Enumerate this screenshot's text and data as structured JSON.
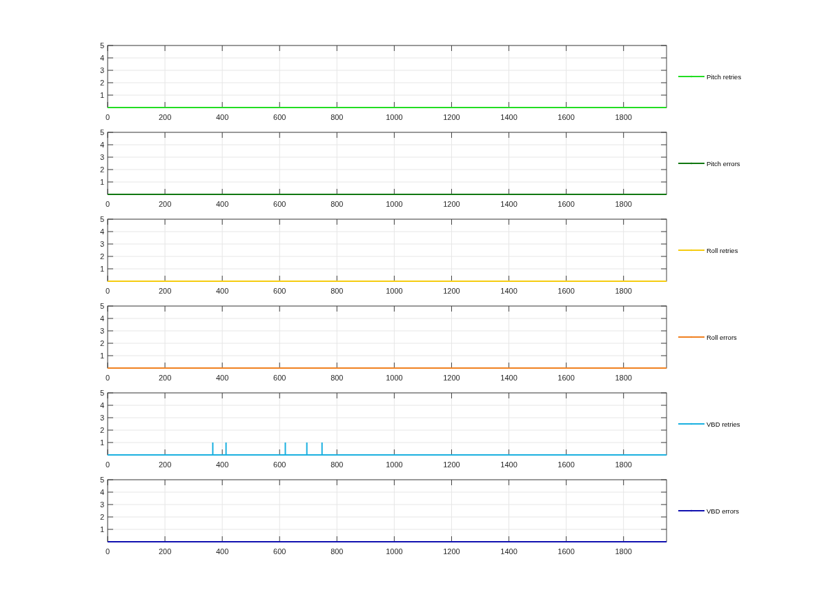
{
  "figure": {
    "subplots": [
      {
        "chart_data": {
          "type": "line",
          "xlim": [
            0,
            1950
          ],
          "ylim": [
            0,
            5
          ],
          "xticks": [
            0,
            200,
            400,
            600,
            800,
            1000,
            1200,
            1400,
            1600,
            1800
          ],
          "yticks": [
            1,
            2,
            3,
            4,
            5
          ],
          "x": [
            0,
            1950
          ],
          "grid": true,
          "series": [
            {
              "name": "Pitch retries",
              "color": "#22dd22",
              "values": [
                0,
                0
              ]
            }
          ]
        }
      },
      {
        "chart_data": {
          "type": "line",
          "xlim": [
            0,
            1950
          ],
          "ylim": [
            0,
            5
          ],
          "xticks": [
            0,
            200,
            400,
            600,
            800,
            1000,
            1200,
            1400,
            1600,
            1800
          ],
          "yticks": [
            1,
            2,
            3,
            4,
            5
          ],
          "x": [
            0,
            1950
          ],
          "grid": true,
          "series": [
            {
              "name": "Pitch errors",
              "color": "#117711",
              "values": [
                0,
                0
              ]
            }
          ]
        }
      },
      {
        "chart_data": {
          "type": "line",
          "xlim": [
            0,
            1950
          ],
          "ylim": [
            0,
            5
          ],
          "xticks": [
            0,
            200,
            400,
            600,
            800,
            1000,
            1200,
            1400,
            1600,
            1800
          ],
          "yticks": [
            1,
            2,
            3,
            4,
            5
          ],
          "x": [
            0,
            1950
          ],
          "grid": true,
          "series": [
            {
              "name": "Roll retries",
              "color": "#f5cc10",
              "values": [
                0,
                0
              ]
            }
          ]
        }
      },
      {
        "chart_data": {
          "type": "line",
          "xlim": [
            0,
            1950
          ],
          "ylim": [
            0,
            5
          ],
          "xticks": [
            0,
            200,
            400,
            600,
            800,
            1000,
            1200,
            1400,
            1600,
            1800
          ],
          "yticks": [
            1,
            2,
            3,
            4,
            5
          ],
          "x": [
            0,
            1950
          ],
          "grid": true,
          "series": [
            {
              "name": "Roll errors",
              "color": "#f08020",
              "values": [
                0,
                0
              ]
            }
          ]
        }
      },
      {
        "chart_data": {
          "type": "line",
          "xlim": [
            0,
            1950
          ],
          "ylim": [
            0,
            5
          ],
          "xticks": [
            0,
            200,
            400,
            600,
            800,
            1000,
            1200,
            1400,
            1600,
            1800
          ],
          "yticks": [
            1,
            2,
            3,
            4,
            5
          ],
          "x": [
            0,
            367,
            367,
            367,
            413,
            413,
            413,
            620,
            620,
            620,
            695,
            695,
            695,
            748,
            748,
            748,
            1950
          ],
          "grid": true,
          "series": [
            {
              "name": "VBD retries",
              "color": "#1ab0e0",
              "values": [
                0,
                0,
                1,
                0,
                0,
                1,
                0,
                0,
                1,
                0,
                0,
                1,
                0,
                0,
                1,
                0,
                0
              ]
            }
          ]
        }
      },
      {
        "chart_data": {
          "type": "line",
          "xlim": [
            0,
            1950
          ],
          "ylim": [
            0,
            5
          ],
          "xticks": [
            0,
            200,
            400,
            600,
            800,
            1000,
            1200,
            1400,
            1600,
            1800
          ],
          "yticks": [
            1,
            2,
            3,
            4,
            5
          ],
          "x": [
            0,
            1950
          ],
          "grid": true,
          "series": [
            {
              "name": "VBD errors",
              "color": "#1010b0",
              "values": [
                0,
                0
              ]
            }
          ]
        }
      }
    ]
  }
}
